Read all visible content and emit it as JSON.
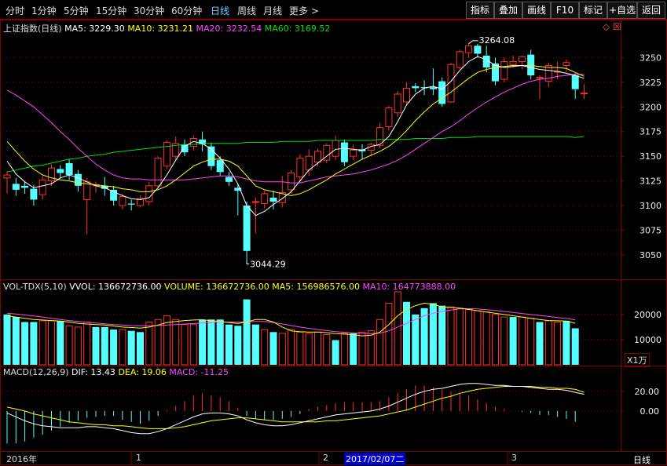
{
  "tabs": [
    "分时",
    "1分钟",
    "5分钟",
    "15分钟",
    "30分钟",
    "60分钟",
    "日线",
    "周线",
    "月线",
    "更多 >"
  ],
  "active_tab": "日线",
  "right_buttons": [
    "指标",
    "叠加",
    "画线",
    "F10",
    "标记",
    "+自选",
    "返回"
  ],
  "main_legend": {
    "title": "上证指数(日线)",
    "ma5": "MA5: 3229.30",
    "ma10": "MA10: 3231.21",
    "ma20": "MA20: 3232.54",
    "ma60": "MA60: 3169.52"
  },
  "vol_legend": {
    "title": "VOL-TDX(5,10)",
    "vvol": "VVOL: 136672736.00",
    "volume": "VOLUME: 136672736.00",
    "ma5": "MA5: 156986576.00",
    "ma10": "MA10: 164773888.00"
  },
  "macd_legend": {
    "title": "MACD(12,26,9)",
    "dif": "DIF: 13.43",
    "dea": "DEA: 19.06",
    "macd": "MACD: -11.25"
  },
  "annotations": {
    "high": "3264.08",
    "low": "3044.29"
  },
  "vol_unit": "X1万",
  "bottom_period": "日线",
  "x_labels": [
    "2016年",
    "1",
    "2",
    "2017/02/07二",
    "3"
  ],
  "colors": {
    "up": "#ff3030",
    "down": "#55ffff",
    "ma5": "#ffffff",
    "ma10": "#ffff00",
    "ma20": "#ff44ff",
    "ma60": "#00dd00",
    "grid": "#800000"
  },
  "chart_data": [
    {
      "type": "candlestick",
      "name": "price",
      "ylim": [
        3030,
        3275
      ],
      "yticks": [
        3050,
        3075,
        3100,
        3125,
        3150,
        3175,
        3200,
        3225,
        3250
      ],
      "candles": [
        [
          3128,
          3131,
          3112,
          3135
        ],
        [
          3122,
          3116,
          3110,
          3128
        ],
        [
          3120,
          3118,
          3112,
          3124
        ],
        [
          3117,
          3106,
          3100,
          3121
        ],
        [
          3111,
          3126,
          3106,
          3130
        ],
        [
          3125,
          3138,
          3120,
          3142
        ],
        [
          3137,
          3133,
          3128,
          3141
        ],
        [
          3143,
          3131,
          3126,
          3147
        ],
        [
          3132,
          3120,
          3114,
          3136
        ],
        [
          3106,
          3124,
          3071,
          3128
        ],
        [
          3120,
          3121,
          3113,
          3124
        ],
        [
          3120,
          3117,
          3110,
          3129
        ],
        [
          3116,
          3105,
          3100,
          3120
        ],
        [
          3100,
          3109,
          3096,
          3112
        ],
        [
          3102,
          3101,
          3095,
          3106
        ],
        [
          3100,
          3107,
          3098,
          3110
        ],
        [
          3104,
          3120,
          3100,
          3124
        ],
        [
          3120,
          3148,
          3118,
          3150
        ],
        [
          3140,
          3164,
          3137,
          3166
        ],
        [
          3150,
          3163,
          3145,
          3170
        ],
        [
          3162,
          3154,
          3150,
          3167
        ],
        [
          3160,
          3168,
          3156,
          3171
        ],
        [
          3167,
          3162,
          3155,
          3175
        ],
        [
          3160,
          3140,
          3136,
          3164
        ],
        [
          3146,
          3134,
          3130,
          3150
        ],
        [
          3129,
          3124,
          3120,
          3134
        ],
        [
          3118,
          3115,
          3090,
          3122
        ],
        [
          3100,
          3054,
          3044,
          3104
        ],
        [
          3104,
          3104,
          3072,
          3108
        ],
        [
          3102,
          3112,
          3097,
          3115
        ],
        [
          3108,
          3104,
          3096,
          3115
        ],
        [
          3103,
          3113,
          3098,
          3130
        ],
        [
          3116,
          3133,
          3112,
          3136
        ],
        [
          3129,
          3148,
          3124,
          3152
        ],
        [
          3136,
          3150,
          3130,
          3157
        ],
        [
          3144,
          3155,
          3140,
          3158
        ],
        [
          3146,
          3161,
          3143,
          3163
        ],
        [
          3150,
          3166,
          3146,
          3171
        ],
        [
          3164,
          3144,
          3140,
          3167
        ],
        [
          3150,
          3156,
          3146,
          3162
        ],
        [
          3157,
          3155,
          3147,
          3162
        ],
        [
          3156,
          3162,
          3150,
          3164
        ],
        [
          3161,
          3179,
          3158,
          3184
        ],
        [
          3180,
          3199,
          3176,
          3201
        ],
        [
          3194,
          3213,
          3190,
          3216
        ],
        [
          3205,
          3219,
          3203,
          3225
        ],
        [
          3221,
          3219,
          3215,
          3224
        ],
        [
          3220,
          3219,
          3212,
          3227
        ],
        [
          3220,
          3218,
          3212,
          3239
        ],
        [
          3226,
          3203,
          3200,
          3230
        ],
        [
          3205,
          3243,
          3204,
          3245
        ],
        [
          3240,
          3256,
          3238,
          3258
        ],
        [
          3255,
          3262,
          3250,
          3264
        ],
        [
          3262,
          3254,
          3250,
          3264
        ],
        [
          3252,
          3240,
          3235,
          3262
        ],
        [
          3244,
          3226,
          3222,
          3250
        ],
        [
          3228,
          3246,
          3225,
          3250
        ],
        [
          3243,
          3246,
          3240,
          3252
        ],
        [
          3246,
          3251,
          3238,
          3252
        ],
        [
          3253,
          3232,
          3228,
          3258
        ],
        [
          3230,
          3230,
          3208,
          3232
        ],
        [
          3226,
          3242,
          3220,
          3245
        ],
        [
          3236,
          3236,
          3228,
          3246
        ],
        [
          3242,
          3245,
          3235,
          3248
        ],
        [
          3232,
          3218,
          3208,
          3234
        ],
        [
          3214,
          3214,
          3208,
          3223
        ]
      ],
      "ma5": [
        3145,
        3132,
        3124,
        3118,
        3120,
        3122,
        3128,
        3131,
        3128,
        3124,
        3120,
        3118,
        3114,
        3110,
        3107,
        3106,
        3108,
        3118,
        3131,
        3146,
        3160,
        3165,
        3163,
        3157,
        3148,
        3137,
        3122,
        3100,
        3090,
        3094,
        3101,
        3107,
        3114,
        3125,
        3136,
        3143,
        3150,
        3157,
        3158,
        3157,
        3156,
        3160,
        3162,
        3170,
        3185,
        3202,
        3213,
        3219,
        3221,
        3218,
        3226,
        3237,
        3246,
        3251,
        3248,
        3242,
        3240,
        3241,
        3242,
        3240,
        3238,
        3237,
        3236,
        3234,
        3232,
        3229
      ],
      "ma10": [
        3165,
        3155,
        3145,
        3137,
        3131,
        3128,
        3126,
        3125,
        3123,
        3122,
        3121,
        3120,
        3119,
        3117,
        3116,
        3114,
        3114,
        3116,
        3120,
        3126,
        3133,
        3140,
        3144,
        3147,
        3147,
        3145,
        3140,
        3130,
        3120,
        3116,
        3114,
        3112,
        3110,
        3112,
        3116,
        3121,
        3126,
        3132,
        3137,
        3142,
        3147,
        3151,
        3155,
        3160,
        3167,
        3176,
        3186,
        3195,
        3203,
        3209,
        3215,
        3222,
        3229,
        3235,
        3238,
        3240,
        3241,
        3242,
        3242,
        3242,
        3241,
        3240,
        3240,
        3239,
        3235,
        3231
      ],
      "ma20": [
        3217,
        3212,
        3206,
        3200,
        3192,
        3184,
        3175,
        3167,
        3158,
        3150,
        3142,
        3136,
        3131,
        3128,
        3127,
        3127,
        3126,
        3126,
        3126,
        3126,
        3126,
        3127,
        3128,
        3129,
        3130,
        3130,
        3129,
        3127,
        3125,
        3124,
        3124,
        3124,
        3123,
        3123,
        3125,
        3127,
        3129,
        3130,
        3131,
        3132,
        3134,
        3136,
        3139,
        3142,
        3146,
        3151,
        3157,
        3163,
        3169,
        3175,
        3180,
        3186,
        3193,
        3199,
        3205,
        3210,
        3215,
        3219,
        3223,
        3226,
        3228,
        3229,
        3231,
        3232,
        3233,
        3233
      ],
      "ma60": [
        3134,
        3136,
        3138,
        3140,
        3141,
        3143,
        3145,
        3147,
        3148,
        3150,
        3151,
        3152,
        3154,
        3155,
        3156,
        3157,
        3158,
        3159,
        3160,
        3161,
        3162,
        3162,
        3163,
        3163,
        3163,
        3163,
        3163,
        3164,
        3164,
        3164,
        3164,
        3165,
        3165,
        3165,
        3165,
        3166,
        3166,
        3166,
        3166,
        3166,
        3166,
        3166,
        3167,
        3167,
        3167,
        3167,
        3168,
        3168,
        3168,
        3168,
        3169,
        3169,
        3169,
        3170,
        3170,
        3170,
        3170,
        3170,
        3170,
        3170,
        3170,
        3170,
        3170,
        3170,
        3169,
        3170
      ]
    },
    {
      "type": "bar",
      "name": "volume",
      "ylim": [
        0,
        29000
      ],
      "yticks": [
        10000,
        20000
      ],
      "up": [
        false,
        false,
        false,
        false,
        true,
        true,
        false,
        true,
        true,
        true,
        false,
        false,
        false,
        true,
        false,
        false,
        true,
        true,
        true,
        true,
        true,
        true,
        false,
        false,
        false,
        false,
        false,
        false,
        false,
        true,
        false,
        true,
        true,
        true,
        true,
        true,
        true,
        false,
        true,
        false,
        true,
        true,
        true,
        true,
        true,
        false,
        false,
        false,
        false,
        false,
        true,
        true,
        true,
        true,
        true,
        true,
        true,
        false,
        true,
        true,
        false,
        true,
        true,
        false,
        false
      ],
      "values": [
        20000,
        19000,
        17000,
        17000,
        17500,
        17500,
        17500,
        15500,
        15000,
        17000,
        15000,
        15000,
        14000,
        14000,
        13500,
        13000,
        17000,
        18000,
        19500,
        18000,
        16000,
        16000,
        18000,
        18000,
        18000,
        16000,
        15500,
        26000,
        16000,
        14000,
        13000,
        12500,
        14000,
        13000,
        12500,
        13000,
        12000,
        9800,
        12500,
        12500,
        13000,
        13500,
        18000,
        24500,
        29000,
        25000,
        20000,
        22500,
        24500,
        23500,
        23000,
        22500,
        22000,
        21500,
        21000,
        20000,
        19000,
        19000,
        19000,
        18500,
        17000,
        17500,
        17000,
        17500,
        14500
      ],
      "ma5": [
        19500,
        19000,
        18500,
        18000,
        17800,
        17600,
        17400,
        17000,
        16500,
        16200,
        16000,
        15800,
        15400,
        15000,
        14800,
        14600,
        15000,
        15800,
        16800,
        17200,
        17600,
        17800,
        17900,
        17500,
        17200,
        16800,
        16400,
        17000,
        18000,
        18000,
        17000,
        15000,
        13500,
        13200,
        13000,
        13000,
        12800,
        12400,
        12200,
        12000,
        11500,
        11800,
        13000,
        16000,
        19500,
        22000,
        23500,
        24500,
        24000,
        23000,
        22800,
        22500,
        22000,
        21500,
        21000,
        20500,
        20000,
        19500,
        19000,
        18500,
        18000,
        17600,
        17500,
        17400,
        16500
      ],
      "ma10": [
        20500,
        20200,
        19800,
        19400,
        19000,
        18500,
        18000,
        17600,
        17200,
        16900,
        16600,
        16300,
        16000,
        15800,
        15600,
        15500,
        15500,
        15600,
        15800,
        16000,
        16200,
        16400,
        16600,
        16800,
        17000,
        17000,
        17000,
        17100,
        17200,
        17200,
        16800,
        16200,
        15600,
        15000,
        14500,
        14000,
        13600,
        13200,
        12900,
        12700,
        12500,
        12400,
        12600,
        13500,
        15000,
        16500,
        18000,
        19500,
        20500,
        21200,
        21800,
        22200,
        22300,
        22200,
        21900,
        21600,
        21200,
        20800,
        20400,
        20000,
        19600,
        19200,
        18800,
        18400,
        17900
      ],
      "unit": "X1万"
    },
    {
      "type": "macd",
      "name": "macd",
      "ylim": [
        -40,
        35
      ],
      "yticks": [
        0,
        20
      ],
      "dif": [
        -2,
        -6,
        -10,
        -13,
        -15,
        -16,
        -17,
        -17,
        -17,
        -16,
        -16,
        -17,
        -18,
        -20,
        -22,
        -23,
        -23,
        -21,
        -18,
        -14,
        -10,
        -6,
        -3,
        -2,
        -2,
        -3,
        -5,
        -9,
        -12,
        -14,
        -15,
        -15,
        -14,
        -12,
        -10,
        -8,
        -6,
        -4,
        -3,
        -2,
        -1,
        0,
        2,
        5,
        9,
        13,
        17,
        20,
        22,
        23,
        25,
        27,
        28,
        28,
        27,
        26,
        26,
        25,
        25,
        24,
        23,
        22,
        22,
        21,
        19,
        17
      ],
      "dea": [
        4,
        2,
        0,
        -3,
        -5,
        -7,
        -9,
        -11,
        -12,
        -13,
        -14,
        -14,
        -15,
        -15,
        -16,
        -17,
        -18,
        -18,
        -18,
        -17,
        -16,
        -14,
        -12,
        -10,
        -9,
        -8,
        -7,
        -7,
        -8,
        -9,
        -10,
        -11,
        -11,
        -11,
        -11,
        -11,
        -10,
        -10,
        -9,
        -8,
        -7,
        -6,
        -5,
        -3,
        -1,
        1,
        4,
        7,
        10,
        13,
        15,
        18,
        20,
        22,
        23,
        24,
        25,
        25,
        25,
        25,
        24,
        24,
        23,
        23,
        22,
        19
      ],
      "macd": [
        -33,
        -33,
        -31,
        -27,
        -24,
        -20,
        -16,
        -12,
        -10,
        -7,
        -6,
        -5,
        -5,
        -9,
        -11,
        -13,
        -10,
        -5,
        1,
        5,
        10,
        16,
        18,
        16,
        14,
        10,
        3,
        -5,
        -8,
        -9,
        -9,
        -8,
        -6,
        -3,
        2,
        4,
        6,
        8,
        9,
        9,
        9,
        9,
        10,
        14,
        18,
        22,
        26,
        26,
        24,
        22,
        20,
        18,
        16,
        12,
        8,
        4,
        2,
        0,
        -1,
        -2,
        -4,
        -4,
        -6,
        -8,
        -11
      ]
    }
  ]
}
